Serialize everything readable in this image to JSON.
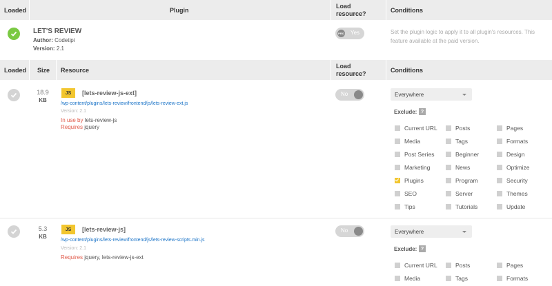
{
  "header1": {
    "loaded": "Loaded",
    "plugin": "Plugin",
    "load_resource_1": "Load",
    "load_resource_2": "resource?",
    "conditions": "Conditions"
  },
  "plugin": {
    "title": "LET'S REVIEW",
    "author_label": "Author:",
    "author": "Codetipi",
    "version_label": "Version:",
    "version": "2.1",
    "toggle_pro": "PRO",
    "toggle_label": "Yes",
    "conditions_note": "Set the plugin logic to apply it to all plugin's resources. This feature available at the paid version."
  },
  "header2": {
    "loaded": "Loaded",
    "size": "Size",
    "resource": "Resource",
    "load_resource_1": "Load",
    "load_resource_2": "resource?",
    "conditions": "Conditions"
  },
  "resources": [
    {
      "size_value": "18.9",
      "size_unit": "KB",
      "badge": "JS",
      "name": "[lets-review-js-ext]",
      "path": "/wp-content/plugins/lets-review/frontend/js/lets-review-ext.js",
      "version": "Version: 2.1",
      "in_use_by_label": "In use by",
      "in_use_by": "lets-review-js",
      "requires_label": "Requires",
      "requires": "jquery",
      "toggle_label": "No",
      "select_value": "Everywhere",
      "exclude_label": "Exclude:",
      "help": "?"
    },
    {
      "size_value": "5.3",
      "size_unit": "KB",
      "badge": "JS",
      "name": "[lets-review-js]",
      "path": "/wp-content/plugins/lets-review/frontend/js/lets-review-scripts.min.js",
      "version": "Version: 2.1",
      "requires_label": "Requires",
      "requires": "jquery, lets-review-js-ext",
      "toggle_label": "No",
      "select_value": "Everywhere",
      "exclude_label": "Exclude:",
      "help": "?"
    }
  ],
  "exclude_options": [
    [
      "Current URL",
      "Posts",
      "Pages"
    ],
    [
      "Media",
      "Tags",
      "Formats"
    ],
    [
      "Post Series",
      "Beginner",
      "Design"
    ],
    [
      "Marketing",
      "News",
      "Optimize"
    ],
    [
      "Plugins",
      "Program",
      "Security"
    ],
    [
      "SEO",
      "Server",
      "Themes"
    ],
    [
      "Tips",
      "Tutorials",
      "Update"
    ]
  ],
  "checked": {
    "plugins": true
  }
}
